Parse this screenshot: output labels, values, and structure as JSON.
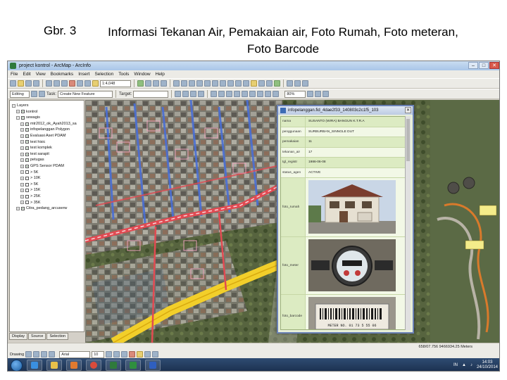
{
  "slide": {
    "figure_label": "Gbr. 3",
    "title_line1": "Informasi Tekanan Air, Pemakaian air, Foto Rumah, Foto meteran,",
    "title_line2": "Foto Barcode"
  },
  "window": {
    "title": "project kontrol - ArcMap - ArcInfo",
    "minimize": "–",
    "maximize": "□",
    "close": "✕"
  },
  "menu": [
    "File",
    "Edit",
    "View",
    "Bookmarks",
    "Insert",
    "Selection",
    "Tools",
    "Window",
    "Help"
  ],
  "toolbar": {
    "scale_value": "1:4,048",
    "editor_label": "Editing",
    "task_label": "Task:",
    "task_value": "Create New Feature",
    "target_label": "Target:",
    "zoom_value": "80%"
  },
  "toc": {
    "items": [
      {
        "label": "Layers",
        "level": 0,
        "checkbox": false,
        "expander": "−"
      },
      {
        "label": "kontrol",
        "level": 1,
        "checkbox": true,
        "expander": "+"
      },
      {
        "label": "sewagis",
        "level": 1,
        "checkbox": true,
        "expander": "−"
      },
      {
        "label": "mtr2012_ok_Ayah2013_sa",
        "level": 2,
        "checkbox": true,
        "expander": "+"
      },
      {
        "label": "infopelanggan Polygon",
        "level": 2,
        "checkbox": true,
        "expander": "+"
      },
      {
        "label": "Evaluasi Aset PDAM",
        "level": 2,
        "checkbox": true,
        "expander": "+"
      },
      {
        "label": "test hisic",
        "level": 2,
        "checkbox": true,
        "expander": "+"
      },
      {
        "label": "test komplek",
        "level": 2,
        "checkbox": true,
        "expander": "+"
      },
      {
        "label": "test sarapit",
        "level": 2,
        "checkbox": true,
        "expander": "+"
      },
      {
        "label": "petugas",
        "level": 2,
        "checkbox": true,
        "expander": "+"
      },
      {
        "label": "GPS Sensor PDAM",
        "level": 2,
        "checkbox": true,
        "expander": "+"
      },
      {
        "label": "> 5K",
        "level": 2,
        "checkbox": false,
        "expander": "+"
      },
      {
        "label": "> 10K",
        "level": 2,
        "checkbox": false,
        "expander": "+"
      },
      {
        "label": "> 5K",
        "level": 2,
        "checkbox": false,
        "expander": "+"
      },
      {
        "label": "> 15K",
        "level": 2,
        "checkbox": false,
        "expander": "+"
      },
      {
        "label": "> 25K",
        "level": 2,
        "checkbox": false,
        "expander": "+"
      },
      {
        "label": "> 35K",
        "level": 2,
        "checkbox": false,
        "expander": "+"
      },
      {
        "label": "Citra_pedang_arcuserw",
        "level": 1,
        "checkbox": true,
        "expander": "+"
      }
    ],
    "tabs": [
      "Display",
      "Source",
      "Selection"
    ]
  },
  "popup": {
    "title": "infopelanggan.fid_4dae2f33_140803c2c1f5_103",
    "close": "✕",
    "fields": [
      {
        "key": "nama",
        "value": "SUSANTO (WIRA) BANGUN K.T.R.A"
      },
      {
        "key": "penggunaan",
        "value": "SURBURBAN_SINNGLE DUT"
      },
      {
        "key": "pemakaian",
        "value": "11"
      },
      {
        "key": "tekanan_air",
        "value": "17"
      },
      {
        "key": "tgl_registr",
        "value": "1986-06-08"
      },
      {
        "key": "status_agen",
        "value": "ACTIVE"
      }
    ],
    "image_fields": [
      {
        "key": "foto_rumah"
      },
      {
        "key": "foto_meter"
      },
      {
        "key": "foto_barcode",
        "barcode_text": "METER NO. 01 73 5 55 06"
      }
    ]
  },
  "status": {
    "coords": "658/07.756  9466934.25 Meters"
  },
  "drawbar": {
    "drawing_label": "Drawing",
    "font_value": "Arial",
    "size_value": "10"
  },
  "taskbar": {
    "clock_time": "14:03",
    "clock_date": "24/10/2014",
    "lang": "IN"
  },
  "colors": {
    "road_red": "#e24a52",
    "road_yellow": "#f2cf2a",
    "pipe_blue": "#4a6fd6",
    "popup_border": "#6b82b5",
    "popup_row": "#dcebc2"
  }
}
